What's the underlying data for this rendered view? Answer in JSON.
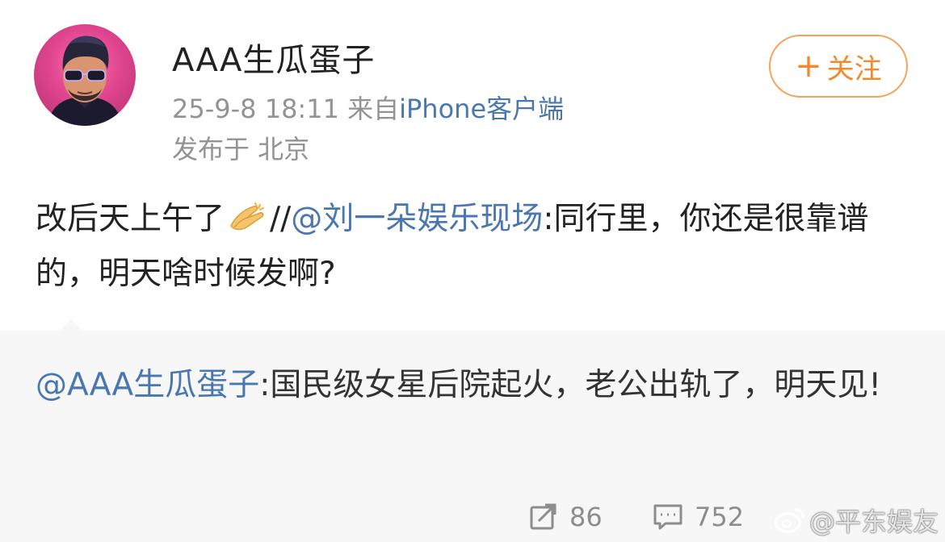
{
  "author": {
    "name": "AAA生瓜蛋子",
    "timestamp": "25-9-8 18:11",
    "source_prefix": "来自",
    "source": "iPhone客户端",
    "location": "发布于 北京"
  },
  "follow_button": {
    "plus": "+",
    "label": "关注"
  },
  "post": {
    "text_before": "改后天上午了",
    "emoji": "clapping-hands-icon",
    "separator": "//",
    "mention": "@刘一朵娱乐现场",
    "text_after": ":同行里，你还是很靠谱的，明天啥时候发啊?"
  },
  "repost": {
    "mention": "@AAA生瓜蛋子",
    "text": ":国民级女星后院起火，老公出轨了，明天见!"
  },
  "stats": {
    "reposts": "86",
    "comments": "752"
  },
  "watermark": {
    "text": "@平东娱友"
  },
  "colors": {
    "accent": "#f28a2c",
    "link": "#4a77b0",
    "muted": "#939393"
  }
}
